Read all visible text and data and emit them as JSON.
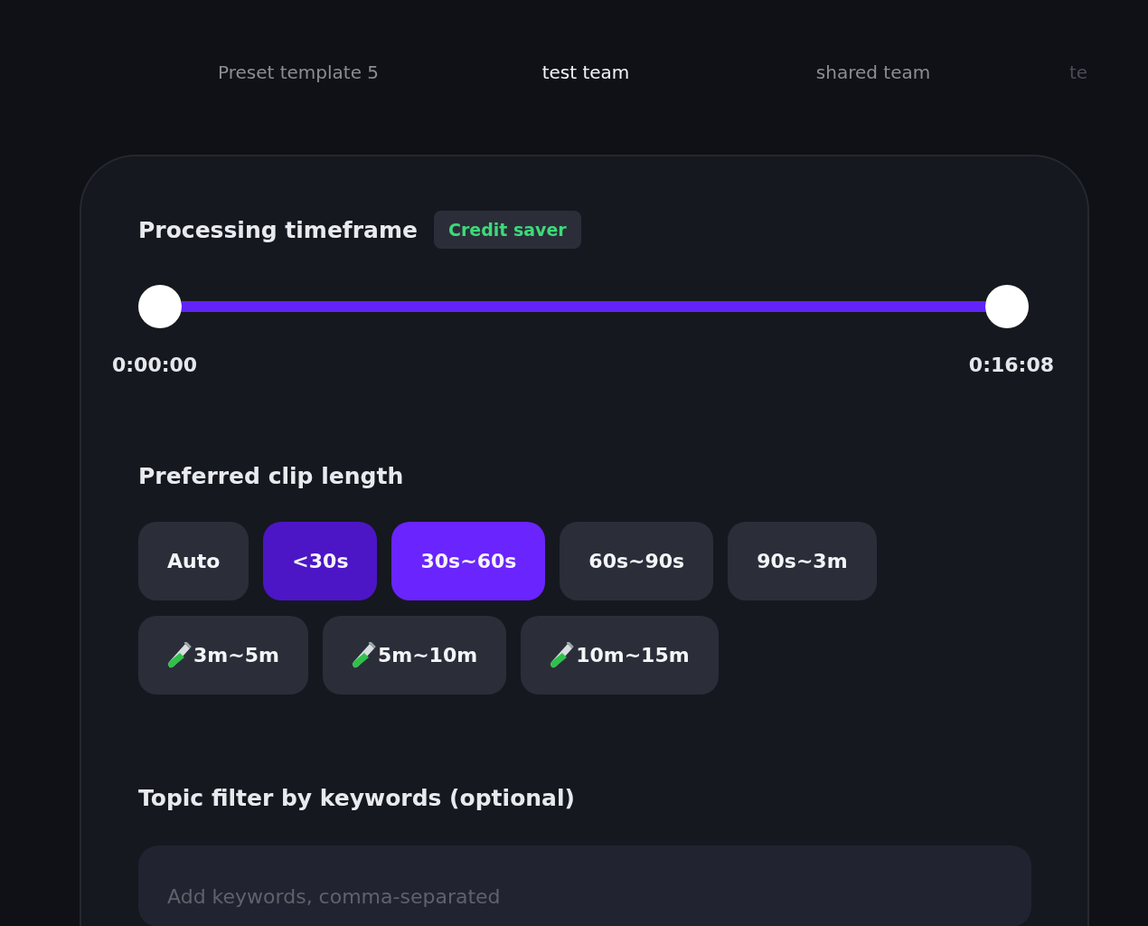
{
  "tabs": [
    {
      "label": "Preset template 5",
      "selected": false,
      "faded": false
    },
    {
      "label": "test team",
      "selected": true,
      "faded": false
    },
    {
      "label": "shared team",
      "selected": false,
      "faded": false
    },
    {
      "label": "te",
      "selected": false,
      "faded": true
    }
  ],
  "timeframe": {
    "title": "Processing timeframe",
    "badge": "Credit saver",
    "start_time": "0:00:00",
    "end_time": "0:16:08"
  },
  "clip_length": {
    "title": "Preferred clip length",
    "options": [
      {
        "label": "Auto",
        "kind": "plain",
        "selected": false,
        "hovered": false
      },
      {
        "label": "<30s",
        "kind": "plain",
        "selected": false,
        "hovered": true
      },
      {
        "label": "30s~60s",
        "kind": "plain",
        "selected": true,
        "hovered": false
      },
      {
        "label": "60s~90s",
        "kind": "plain",
        "selected": false,
        "hovered": false
      },
      {
        "label": "90s~3m",
        "kind": "plain",
        "selected": false,
        "hovered": false
      },
      {
        "label": "3m~5m",
        "kind": "experimental",
        "selected": false,
        "hovered": false
      },
      {
        "label": "5m~10m",
        "kind": "experimental",
        "selected": false,
        "hovered": false
      },
      {
        "label": "10m~15m",
        "kind": "experimental",
        "selected": false,
        "hovered": false
      }
    ]
  },
  "topic_filter": {
    "title": "Topic filter by keywords (optional)",
    "placeholder": "Add keywords, comma-separated"
  }
}
